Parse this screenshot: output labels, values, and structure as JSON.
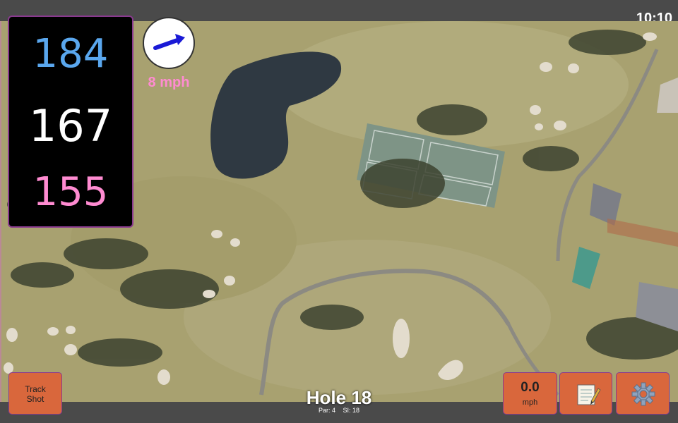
{
  "status_bar": {
    "time": "10:10"
  },
  "distances": {
    "back": "184",
    "middle": "167",
    "front": "155",
    "colors": {
      "back": "#5aa7ee",
      "middle": "#ffffff",
      "front": "#ff8bd1"
    }
  },
  "wind": {
    "speed_label": "8 mph",
    "icon": "wind-direction-arrow-icon",
    "arrow_color": "#1a1ad6"
  },
  "buttons": {
    "track_shot": {
      "line1": "Track",
      "line2": "Shot"
    },
    "wind_speed": {
      "value": "0.0",
      "unit": "mph"
    },
    "notes": {
      "icon": "notepad-icon"
    },
    "settings": {
      "icon": "gear-icon"
    }
  },
  "hole": {
    "title": "Hole 18",
    "par": "Par: 4",
    "si": "SI: 18"
  },
  "theme": {
    "button_color": "#d9673c",
    "panel_border": "#8a3a8f"
  }
}
